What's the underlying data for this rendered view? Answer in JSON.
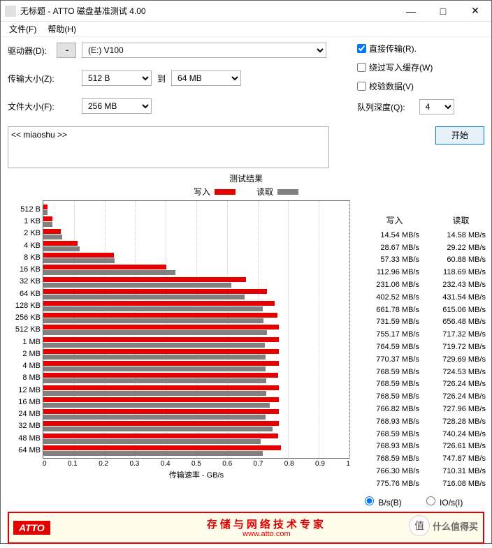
{
  "window": {
    "title": "无标题 - ATTO 磁盘基准测试 4.00"
  },
  "menu": {
    "file": "文件(F)",
    "help": "帮助(H)"
  },
  "form": {
    "drive_label": "驱动器(D):",
    "browse": "...",
    "drive_value": "(E:) V100",
    "xfer_label": "传输大小(Z):",
    "xfer_from": "512 B",
    "to": "到",
    "xfer_to": "64 MB",
    "file_label": "文件大小(F):",
    "file_value": "256 MB",
    "direct": "直接传输(R).",
    "bypass": "绕过写入缓存(W)",
    "verify": "校验数据(V)",
    "queue_label": "队列深度(Q):",
    "queue_value": "4",
    "textarea": "<< miaoshu >>",
    "start": "开始"
  },
  "results": {
    "title": "测试结果",
    "legend_write": "写入",
    "legend_read": "读取",
    "x_title": "传输速率 - GB/s",
    "col_write": "写入",
    "col_read": "读取",
    "unit_bs": "B/s(B)",
    "unit_ios": "IO/s(I)",
    "xticks": [
      "0",
      "0.1",
      "0.2",
      "0.3",
      "0.4",
      "0.5",
      "0.6",
      "0.7",
      "0.8",
      "0.9",
      "1"
    ]
  },
  "banner": {
    "logo": "ATTO",
    "main": "存储与网络技术专家",
    "sub": "www.atto.com"
  },
  "watermark": {
    "icon": "值",
    "text": "什么值得买"
  },
  "chart_data": {
    "type": "bar",
    "orientation": "horizontal",
    "xlabel": "传输速率 - GB/s",
    "xlim": [
      0,
      1000
    ],
    "unit": "MB/s",
    "categories": [
      "512 B",
      "1 KB",
      "2 KB",
      "4 KB",
      "8 KB",
      "16 KB",
      "32 KB",
      "64 KB",
      "128 KB",
      "256 KB",
      "512 KB",
      "1 MB",
      "2 MB",
      "4 MB",
      "8 MB",
      "12 MB",
      "16 MB",
      "24 MB",
      "32 MB",
      "48 MB",
      "64 MB"
    ],
    "series": [
      {
        "name": "写入",
        "color": "#e50000",
        "values": [
          14.54,
          28.67,
          57.33,
          112.96,
          231.06,
          402.52,
          661.78,
          731.59,
          755.17,
          764.59,
          770.37,
          768.59,
          768.59,
          768.59,
          766.82,
          768.93,
          768.59,
          768.93,
          768.59,
          766.3,
          775.76
        ],
        "display": [
          "14.54 MB/s",
          "28.67 MB/s",
          "57.33 MB/s",
          "112.96 MB/s",
          "231.06 MB/s",
          "402.52 MB/s",
          "661.78 MB/s",
          "731.59 MB/s",
          "755.17 MB/s",
          "764.59 MB/s",
          "770.37 MB/s",
          "768.59 MB/s",
          "768.59 MB/s",
          "768.59 MB/s",
          "766.82 MB/s",
          "768.93 MB/s",
          "768.59 MB/s",
          "768.93 MB/s",
          "768.59 MB/s",
          "766.30 MB/s",
          "775.76 MB/s"
        ]
      },
      {
        "name": "读取",
        "color": "#808080",
        "values": [
          14.58,
          29.22,
          60.88,
          118.69,
          232.43,
          431.54,
          615.06,
          656.48,
          717.32,
          719.72,
          729.69,
          724.53,
          726.24,
          726.24,
          727.96,
          728.28,
          740.24,
          726.61,
          747.87,
          710.31,
          716.08
        ],
        "display": [
          "14.58 MB/s",
          "29.22 MB/s",
          "60.88 MB/s",
          "118.69 MB/s",
          "232.43 MB/s",
          "431.54 MB/s",
          "615.06 MB/s",
          "656.48 MB/s",
          "717.32 MB/s",
          "719.72 MB/s",
          "729.69 MB/s",
          "724.53 MB/s",
          "726.24 MB/s",
          "726.24 MB/s",
          "727.96 MB/s",
          "728.28 MB/s",
          "740.24 MB/s",
          "726.61 MB/s",
          "747.87 MB/s",
          "710.31 MB/s",
          "716.08 MB/s"
        ]
      }
    ]
  }
}
